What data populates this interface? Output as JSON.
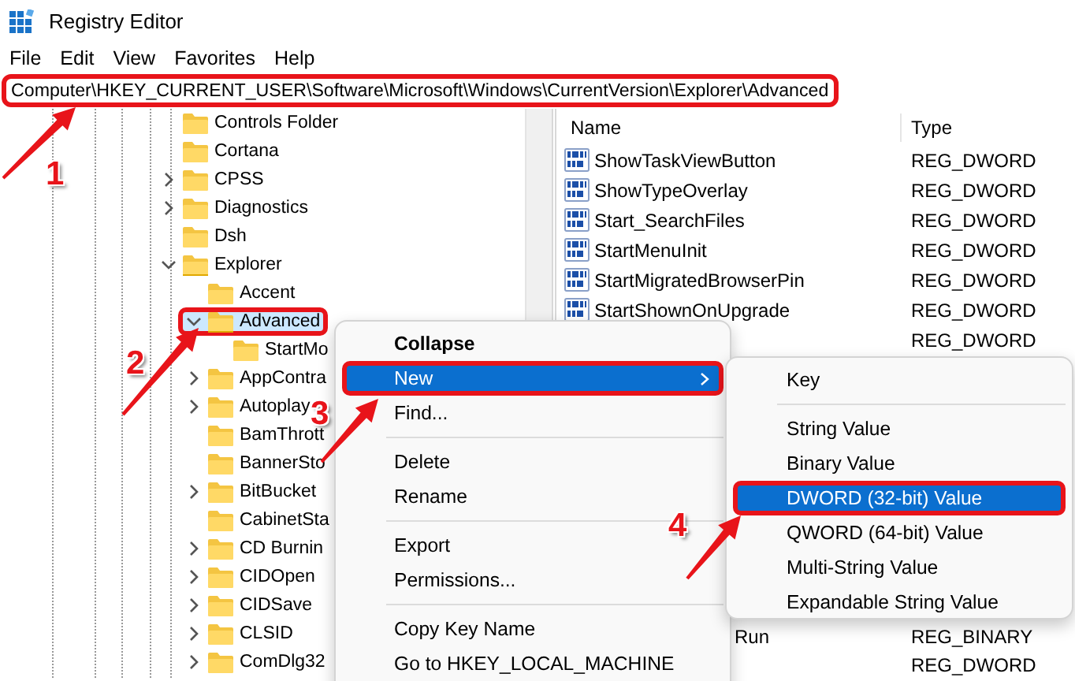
{
  "window": {
    "title": "Registry Editor"
  },
  "menu_bar": [
    "File",
    "Edit",
    "View",
    "Favorites",
    "Help"
  ],
  "address_bar": {
    "value": "Computer\\HKEY_CURRENT_USER\\Software\\Microsoft\\Windows\\CurrentVersion\\Explorer\\Advanced",
    "outlined": true
  },
  "tree": [
    {
      "label": "Controls Folder",
      "selected": false,
      "outlined": false
    },
    {
      "label": "Cortana",
      "selected": false,
      "outlined": false
    },
    {
      "label": "CPSS",
      "expanded": false,
      "selected": false,
      "outlined": false
    },
    {
      "label": "Diagnostics",
      "expanded": false,
      "selected": false,
      "outlined": false
    },
    {
      "label": "Dsh",
      "selected": false,
      "outlined": false
    },
    {
      "label": "Explorer",
      "expanded": true,
      "selected": false,
      "outlined": false,
      "children": [
        {
          "label": "Accent",
          "selected": false,
          "outlined": false
        },
        {
          "label": "Advanced",
          "expanded": true,
          "selected": true,
          "outlined": true,
          "children": [
            {
              "label": "StartMo",
              "selected": false,
              "outlined": false
            }
          ]
        },
        {
          "label": "AppContra",
          "expanded": false,
          "selected": false,
          "outlined": false
        },
        {
          "label": "Autoplay",
          "expanded": false,
          "selected": false,
          "outlined": false
        },
        {
          "label": "BamThrott",
          "selected": false,
          "outlined": false
        },
        {
          "label": "BannerSto",
          "selected": false,
          "outlined": false
        },
        {
          "label": "BitBucket",
          "expanded": false,
          "selected": false,
          "outlined": false
        },
        {
          "label": "CabinetSta",
          "selected": false,
          "outlined": false
        },
        {
          "label": "CD Burnin",
          "expanded": false,
          "selected": false,
          "outlined": false
        },
        {
          "label": "CIDOpen",
          "expanded": false,
          "selected": false,
          "outlined": false
        },
        {
          "label": "CIDSave",
          "expanded": false,
          "selected": false,
          "outlined": false
        },
        {
          "label": "CLSID",
          "expanded": false,
          "selected": false,
          "outlined": false
        },
        {
          "label": "ComDlg32",
          "expanded": false,
          "selected": false,
          "outlined": false
        }
      ]
    }
  ],
  "values": {
    "columns": [
      "Name",
      "Type"
    ],
    "rows": [
      {
        "name": "ShowTaskViewButton",
        "type": "REG_DWORD"
      },
      {
        "name": "ShowTypeOverlay",
        "type": "REG_DWORD"
      },
      {
        "name": "Start_SearchFiles",
        "type": "REG_DWORD"
      },
      {
        "name": "StartMenuInit",
        "type": "REG_DWORD"
      },
      {
        "name": "StartMigratedBrowserPin",
        "type": "REG_DWORD"
      },
      {
        "name": "StartShownOnUpgrade",
        "type": "REG_DWORD"
      },
      {
        "type": "REG_DWORD"
      }
    ],
    "bottom_rows": [
      {
        "name": "Run",
        "type": "REG_BINARY"
      },
      {
        "type": "REG_DWORD"
      }
    ]
  },
  "context_menu": {
    "items": [
      {
        "kind": "default",
        "label": "Collapse",
        "selected": false,
        "outlined": false
      },
      {
        "kind": "submenu",
        "label": "New",
        "selected": true,
        "outlined": true
      },
      {
        "kind": "item",
        "label": "Find...",
        "selected": false,
        "outlined": false
      },
      {
        "kind": "separator"
      },
      {
        "kind": "item",
        "label": "Delete",
        "selected": false,
        "outlined": false
      },
      {
        "kind": "item",
        "label": "Rename",
        "selected": false,
        "outlined": false
      },
      {
        "kind": "separator"
      },
      {
        "kind": "item",
        "label": "Export",
        "selected": false,
        "outlined": false
      },
      {
        "kind": "item",
        "label": "Permissions...",
        "selected": false,
        "outlined": false
      },
      {
        "kind": "separator"
      },
      {
        "kind": "item",
        "label": "Copy Key Name",
        "selected": false,
        "outlined": false
      },
      {
        "kind": "item",
        "label": "Go to HKEY_LOCAL_MACHINE",
        "selected": false,
        "outlined": false
      }
    ]
  },
  "submenu": {
    "items": [
      {
        "kind": "item",
        "label": "Key",
        "selected": false,
        "outlined": false
      },
      {
        "kind": "separator"
      },
      {
        "kind": "item",
        "label": "String Value",
        "selected": false,
        "outlined": false
      },
      {
        "kind": "item",
        "label": "Binary Value",
        "selected": false,
        "outlined": false
      },
      {
        "kind": "item",
        "label": "DWORD (32-bit) Value",
        "selected": true,
        "outlined": true
      },
      {
        "kind": "item",
        "label": "QWORD (64-bit) Value",
        "selected": false,
        "outlined": false
      },
      {
        "kind": "item",
        "label": "Multi-String Value",
        "selected": false,
        "outlined": false
      },
      {
        "kind": "item",
        "label": "Expandable String Value",
        "selected": false,
        "outlined": false
      }
    ]
  },
  "callouts": [
    {
      "label": "1"
    },
    {
      "label": "2"
    },
    {
      "label": "3"
    },
    {
      "label": "4"
    }
  ]
}
